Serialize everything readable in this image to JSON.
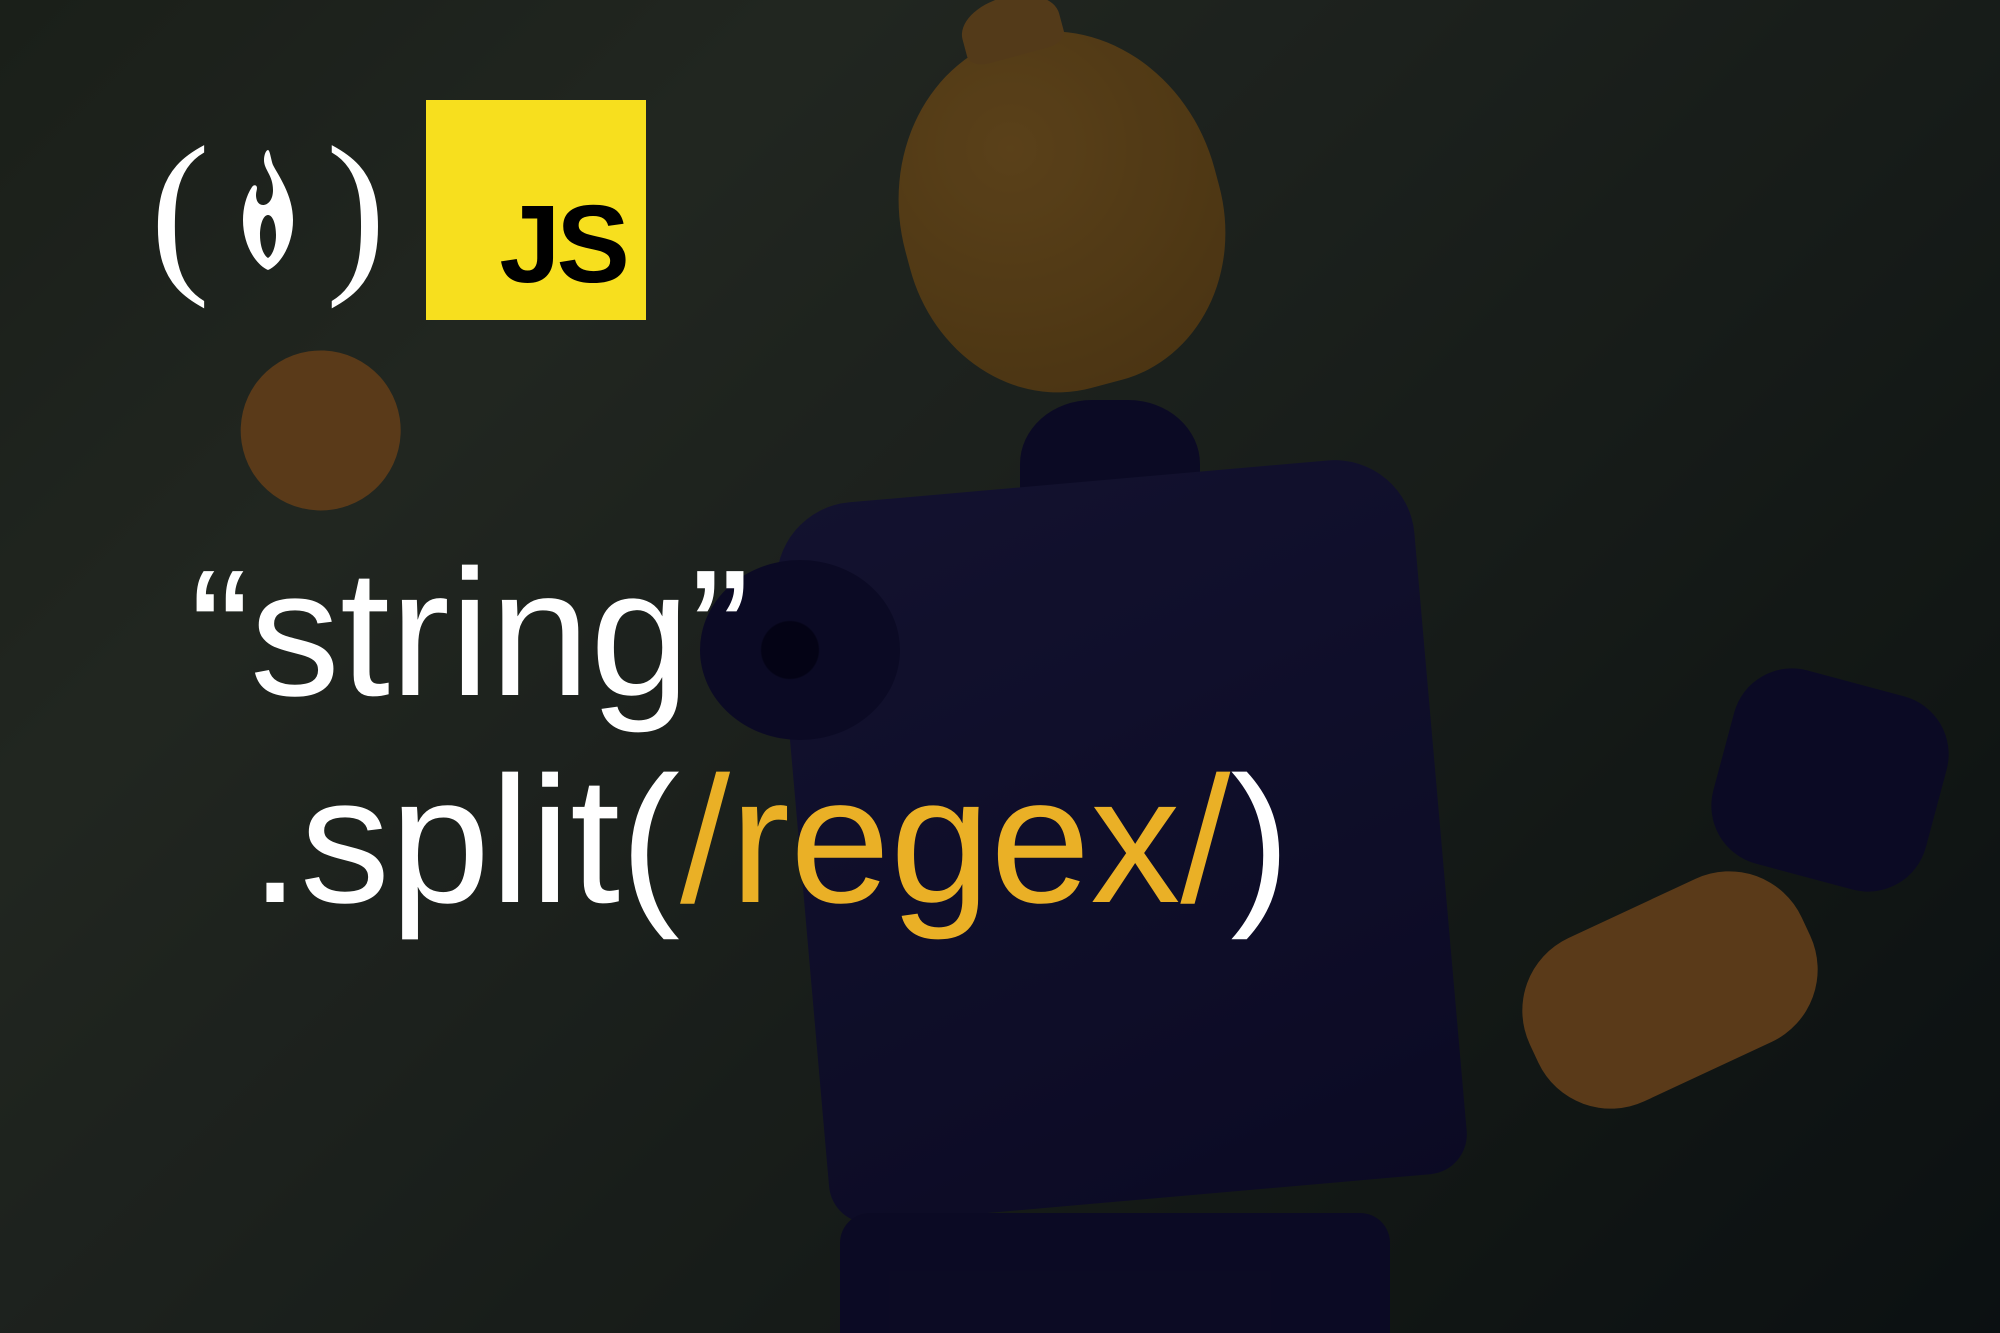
{
  "logos": {
    "fcc_paren_left": "(",
    "fcc_paren_right": ")",
    "js_label": "JS"
  },
  "code": {
    "line1": "“string”",
    "line2_prefix": ".split(",
    "line2_regex": "/regex/",
    "line2_suffix": ")"
  },
  "colors": {
    "js_yellow": "#f7df1e",
    "regex_gold": "#eab026",
    "text_white": "#ffffff"
  }
}
